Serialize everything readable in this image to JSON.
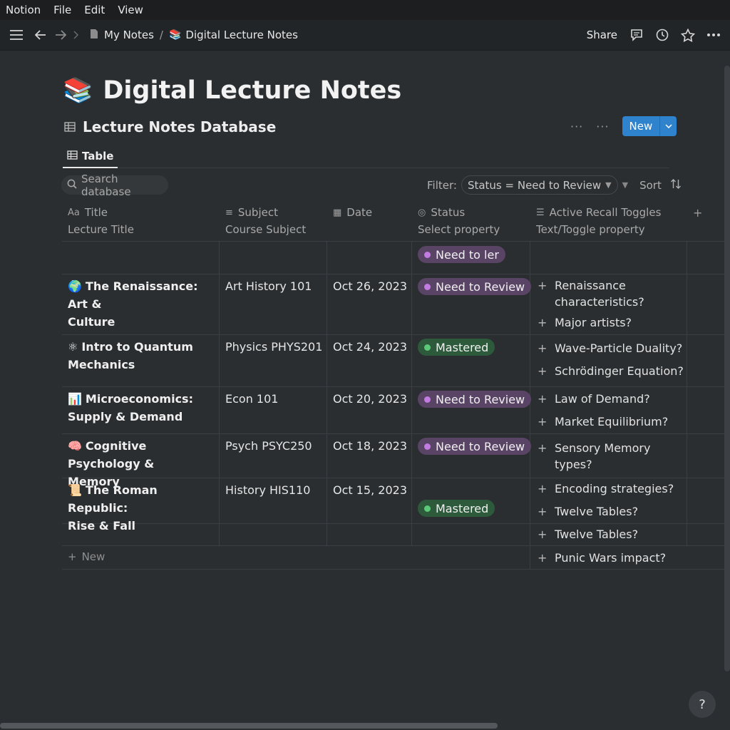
{
  "menubar": {
    "app": "Notion",
    "file": "File",
    "edit": "Edit",
    "view": "View"
  },
  "topbar": {
    "crumb_root": "My Notes",
    "crumb_sep": "/",
    "crumb_page_emoji": "📚",
    "crumb_page": "Digital Lecture Notes",
    "share": "Share"
  },
  "page": {
    "emoji": "📚",
    "title": "Digital Lecture Notes"
  },
  "database": {
    "title": "Lecture Notes Database",
    "dots_left": "···",
    "dots_right": "···",
    "new_label": "New",
    "view_tab": "Table",
    "search_placeholder": "Search database",
    "filter_label": "Filter:",
    "filter_value": "Status = Need to Review",
    "sort_label": "Sort",
    "add_column": "+",
    "new_row": "New"
  },
  "columns": [
    {
      "icon": "Aa",
      "name": "Title",
      "sub": "Lecture Title"
    },
    {
      "icon": "≡",
      "name": "Subject",
      "sub": "Course Subject"
    },
    {
      "icon": "▦",
      "name": "Date",
      "sub": ""
    },
    {
      "icon": "◎",
      "name": "Status",
      "sub": "Select property"
    },
    {
      "icon": "☰",
      "name": "Active Recall Toggles",
      "sub": "Text/Toggle property"
    }
  ],
  "rows": [
    {
      "emoji": "",
      "title_line1": "",
      "title_line2": "",
      "subject": "",
      "date": "",
      "status": "Need to ler",
      "status_type": "review"
    },
    {
      "emoji": "🌍",
      "title_line1": "The Renaissance: Art &",
      "title_line2": "Culture",
      "subject": "Art History 101",
      "date": "Oct 26, 2023",
      "status": "Need to Review",
      "status_type": "review"
    },
    {
      "emoji": "⚛",
      "title_line1": "Intro to Quantum",
      "title_line2": "Mechanics",
      "subject": "Physics PHYS201",
      "date": "Oct 24, 2023",
      "status": "Mastered",
      "status_type": "mastered"
    },
    {
      "emoji": "📊",
      "title_line1": "Microeconomics:",
      "title_line2": "Supply & Demand",
      "subject": "Econ 101",
      "date": "Oct 20, 2023",
      "status": "Need to Review",
      "status_type": "review"
    },
    {
      "emoji": "🧠",
      "title_line1": "Cognitive Psychology &",
      "title_line2": "Memory",
      "subject": "Psych PSYC250",
      "date": "Oct 18, 2023",
      "status": "Need to Review",
      "status_type": "review"
    },
    {
      "emoji": "📜",
      "title_line1": "The Roman Republic:",
      "title_line2": "Rise & Fall",
      "subject": "History HIS110",
      "date": "Oct 15, 2023",
      "status": "Mastered",
      "status_type": "mastered"
    }
  ],
  "toggles": [
    {
      "line1": "Renaissance",
      "line2": "characteristics?"
    },
    {
      "line1": "Major artists?",
      "line2": ""
    },
    {
      "line1": "Wave-Particle Duality?",
      "line2": ""
    },
    {
      "line1": "Schrödinger Equation?",
      "line2": ""
    },
    {
      "line1": "Law of Demand?",
      "line2": ""
    },
    {
      "line1": "Market Equilibrium?",
      "line2": ""
    },
    {
      "line1": "Sensory Memory",
      "line2": "types?"
    },
    {
      "line1": "Encoding strategies?",
      "line2": ""
    },
    {
      "line1": "Twelve Tables?",
      "line2": ""
    },
    {
      "line1": "Twelve Tables?",
      "line2": ""
    },
    {
      "line1": "Punic Wars impact?",
      "line2": ""
    }
  ],
  "help": "?",
  "colors": {
    "accent": "#2f83cc",
    "review": "#5a4466",
    "mastered": "#2e5a3c",
    "background": "#2a2e31"
  }
}
